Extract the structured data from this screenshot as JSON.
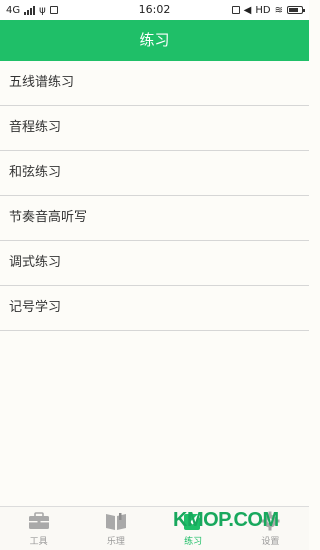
{
  "status_bar": {
    "network": "4G",
    "time": "16:02",
    "hd_label": "HD"
  },
  "header": {
    "title": "练习"
  },
  "menu": {
    "items": [
      {
        "label": "五线谱练习"
      },
      {
        "label": "音程练习"
      },
      {
        "label": "和弦练习"
      },
      {
        "label": "节奏音高听写"
      },
      {
        "label": "调式练习"
      },
      {
        "label": "记号学习"
      }
    ]
  },
  "tabs": [
    {
      "label": "工具",
      "icon": "toolbox-icon",
      "active": false
    },
    {
      "label": "乐理",
      "icon": "book-icon",
      "active": false
    },
    {
      "label": "练习",
      "icon": "edit-icon",
      "active": true
    },
    {
      "label": "设置",
      "icon": "gear-icon",
      "active": false
    }
  ],
  "watermark": "KMOP.COM",
  "colors": {
    "accent": "#1fbf68",
    "inactive": "#999999"
  }
}
